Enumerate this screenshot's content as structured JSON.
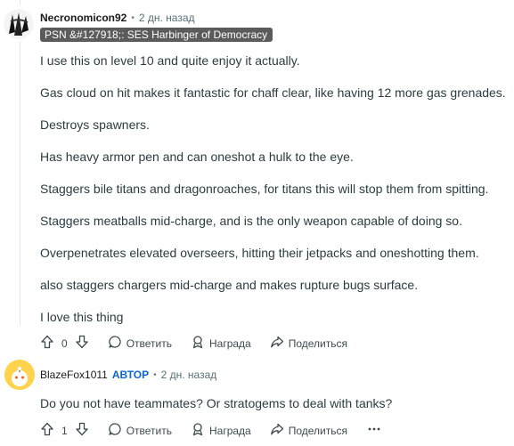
{
  "comments": [
    {
      "author": "Necronomicon92",
      "time": "2 дн. назад",
      "flair": "PSN &#127918;: SES Harbinger of Democracy",
      "paragraphs": [
        "I use this on level 10 and quite enjoy it actually.",
        "Gas cloud on hit makes it fantastic for chaff clear, like having 12 more gas grenades.",
        "Destroys spawners.",
        "Has heavy armor pen and can oneshot a hulk to the eye.",
        "Staggers bile titans and dragonroaches, for titans this will stop them from spitting.",
        "Staggers meatballs mid-charge, and is the only weapon capable of doing so.",
        "Overpenetrates elevated overseers, hitting their jetpacks and oneshotting them.",
        "also staggers chargers mid-charge and makes rupture bugs surface.",
        "I love this thing"
      ],
      "votes": "0",
      "reply_label": "Ответить",
      "award_label": "Награда",
      "share_label": "Поделиться"
    },
    {
      "author": "BlazeFox1011",
      "op_badge": "АВТОР",
      "time": "2 дн. назад",
      "paragraphs": [
        "Do you not have teammates? Or stratogems to deal with tanks?"
      ],
      "votes": "1",
      "reply_label": "Ответить",
      "award_label": "Награда",
      "share_label": "Поделиться"
    }
  ],
  "colors": {
    "flair_bg": "#5b5b5b",
    "op_badge": "#0a66d8",
    "text": "#2a3c42"
  }
}
